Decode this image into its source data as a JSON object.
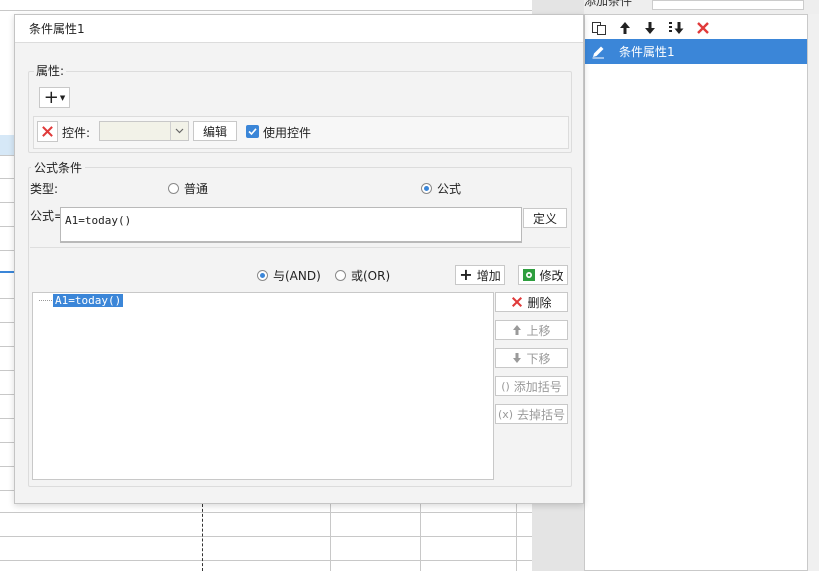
{
  "right_panel": {
    "top_strip_text": "添加条件",
    "items": [
      {
        "label": "条件属性1"
      }
    ],
    "toolbar": [
      "copy-icon",
      "arrow-up-icon",
      "arrow-down-icon",
      "move-bottom-icon",
      "delete-icon"
    ]
  },
  "dialog": {
    "title": "条件属性1",
    "properties": {
      "legend": "属性:",
      "add_symbol": "+",
      "widget_label": "控件:",
      "widget_value": "",
      "edit_button": "编辑",
      "use_widget_label": "使用控件",
      "use_widget_checked": true
    },
    "formula_condition": {
      "legend": "公式条件",
      "type_label": "类型:",
      "type_options": [
        "普通",
        "公式"
      ],
      "type_selected": "公式",
      "formula_label": "公式=",
      "formula_value": "A1=today()",
      "define_button": "定义",
      "logic_options": [
        "与(AND)",
        "或(OR)"
      ],
      "logic_selected": "与(AND)",
      "add_button": "增加",
      "modify_button": "修改",
      "conditions": [
        "A1=today()"
      ],
      "side_buttons": {
        "delete": "删除",
        "move_up": "上移",
        "move_down": "下移",
        "add_brackets": "添加括号",
        "remove_brackets": "去掉括号"
      }
    }
  },
  "colors": {
    "accent": "#3b86d8",
    "delete_red": "#e03a3a",
    "modify_green": "#2e9e3e"
  }
}
